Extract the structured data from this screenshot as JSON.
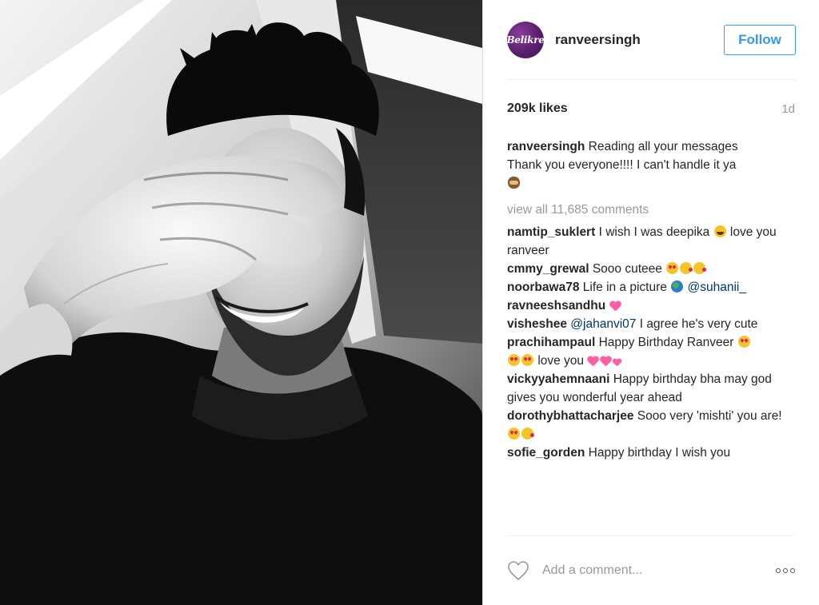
{
  "header": {
    "avatar_text": "Belikre",
    "username": "ranveersingh",
    "follow_label": "Follow"
  },
  "stats": {
    "likes": "209k likes",
    "timestamp": "1d"
  },
  "caption": {
    "user": "ranveersingh",
    "text_line1": "Reading all your messages",
    "text_line2": "Thank you everyone!!!! I can't handle it ya",
    "emoji": "see-no-evil-monkey-emoji"
  },
  "view_all_comments": "view all 11,685 comments",
  "comments": [
    {
      "user": "namtip_suklert",
      "text_before": "I wish I was deepika",
      "emoji": "tears-of-joy-emoji",
      "text_after": "love you ranveer"
    },
    {
      "user": "cmmy_grewal",
      "text": "Sooo cuteee",
      "emojis": [
        "heart-eyes-emoji",
        "kissing-heart-emoji",
        "kissing-heart-emoji"
      ]
    },
    {
      "user": "noorbawa78",
      "text": "Life in a picture",
      "emoji": "earth-globe-emoji",
      "mention": "@suhanii_"
    },
    {
      "user": "ravneeshsandhu",
      "emoji": "heart-with-ribbon-emoji"
    },
    {
      "user": "visheshee",
      "mention": "@jahanvi07",
      "text": "I agree he's very cute"
    },
    {
      "user": "prachihampaul",
      "text_before": "Happy Birthday Ranveer",
      "text_after": "love you"
    },
    {
      "user": "vickyyahemnaani",
      "text": "Happy birthday bha may god gives you wonderful year ahead"
    },
    {
      "user": "dorothybhattacharjee",
      "text_before": "Sooo very 'mishti'",
      "text_after": "you are!"
    },
    {
      "user": "sofie_gorden",
      "text": "Happy birthday I wish you"
    }
  ],
  "footer": {
    "placeholder": "Add a comment...",
    "like_icon": "heart-outline-icon",
    "more_icon": "more-options-icon"
  },
  "colors": {
    "accent": "#3897f0",
    "mention": "#003569",
    "muted": "#999999",
    "text": "#262626"
  }
}
